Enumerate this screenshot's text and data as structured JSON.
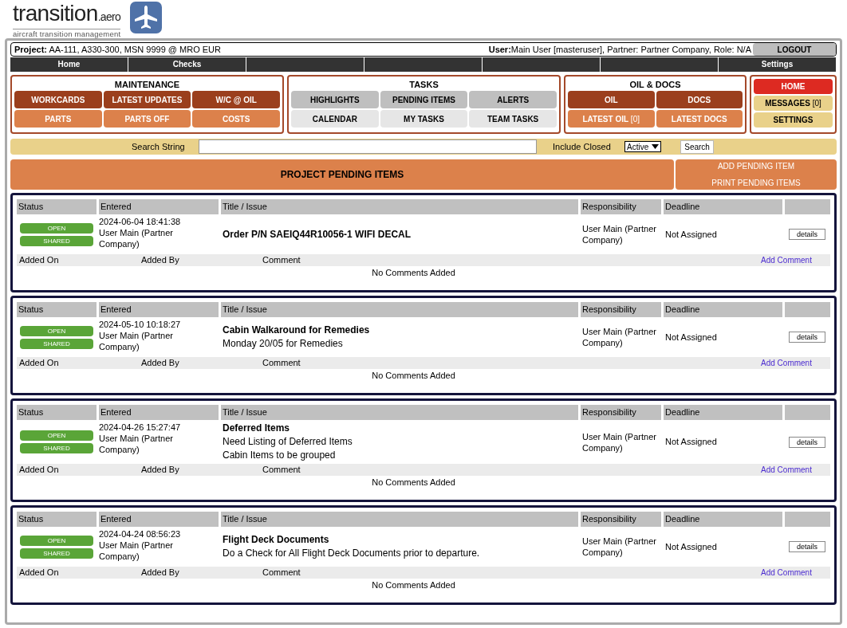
{
  "logo": {
    "name": "transition",
    "suffix": ".aero",
    "tagline": "aircraft transition management"
  },
  "project_bar": {
    "project_label": "Project:",
    "project": "AA-111, A330-300, MSN 9999 @ MRO EUR",
    "user_label": "User:",
    "user": "Main User [masteruser], Partner: Partner Company, Role: N/A",
    "logout": "LOGOUT"
  },
  "nav": [
    {
      "kind": "tab",
      "label": "Home"
    },
    {
      "kind": "tab",
      "label": "Checks"
    },
    {
      "kind": "blank"
    },
    {
      "kind": "blank"
    },
    {
      "kind": "blank"
    },
    {
      "kind": "blank"
    },
    {
      "kind": "tab",
      "label": "Settings"
    }
  ],
  "panels": [
    {
      "title": "MAINTENANCE",
      "buttons": [
        {
          "label": "WORKCARDS",
          "kind": "dark"
        },
        {
          "label": "LATEST UPDATES",
          "kind": "dark"
        },
        {
          "label": "W/C @ OIL",
          "kind": "dark"
        },
        {
          "label": "PARTS",
          "kind": "light"
        },
        {
          "label": "PARTS OFF",
          "kind": "light"
        },
        {
          "label": "COSTS",
          "kind": "light"
        }
      ]
    },
    {
      "title": "TASKS",
      "buttons": [
        {
          "label": "HIGHLIGHTS",
          "kind": "gray"
        },
        {
          "label": "PENDING ITEMS",
          "kind": "gray"
        },
        {
          "label": "ALERTS",
          "kind": "gray"
        },
        {
          "label": "CALENDAR",
          "kind": "pale"
        },
        {
          "label": "MY TASKS",
          "kind": "pale"
        },
        {
          "label": "TEAM TASKS",
          "kind": "pale"
        }
      ]
    },
    {
      "title": "OIL & DOCS",
      "buttons": [
        {
          "label": "OIL",
          "kind": "dark"
        },
        {
          "label": "DOCS",
          "kind": "dark"
        },
        {
          "label": "LATEST OIL",
          "count": "[0]",
          "kind": "light"
        },
        {
          "label": "LATEST DOCS",
          "kind": "light"
        }
      ]
    }
  ],
  "side_buttons": [
    {
      "label": "HOME",
      "kind": "red"
    },
    {
      "label": "MESSAGES",
      "count": "[0]",
      "kind": "yellow"
    },
    {
      "label": "SETTINGS",
      "kind": "yellow"
    }
  ],
  "search": {
    "label": "Search String",
    "include_closed_label": "Include Closed",
    "filter": "Active",
    "button": "Search"
  },
  "heading": {
    "title": "PROJECT PENDING ITEMS",
    "actions": [
      "ADD PENDING ITEM",
      "PRINT PENDING ITEMS"
    ]
  },
  "items": [
    {
      "columns": [
        "Status",
        "Entered",
        "Title / Issue",
        "Responsibility",
        "Deadline"
      ],
      "comment_columns": [
        "Added On",
        "Added By",
        "Comment"
      ],
      "statuses": [
        "OPEN",
        "SHARED"
      ],
      "entered": "2024-06-04 18:41:38",
      "entered_by": "User Main (Partner Company)",
      "title": "Order P/N SAEIQ44R10056-1 WIFI DECAL",
      "responsibility": "User Main (Partner Company)",
      "deadline": "Not Assigned",
      "details": "details",
      "add_comment": "Add Comment",
      "comments_note": "No Comments Added"
    },
    {
      "columns": [
        "Status",
        "Entered",
        "Title / Issue",
        "Responsibility",
        "Deadline"
      ],
      "comment_columns": [
        "Added On",
        "Added By",
        "Comment"
      ],
      "statuses": [
        "OPEN",
        "SHARED"
      ],
      "entered": "2024-05-10 10:18:27",
      "entered_by": "User Main (Partner Company)",
      "title": "Cabin Walkaround for Remedies",
      "description": [
        "Monday 20/05 for Remedies"
      ],
      "responsibility": "User Main (Partner Company)",
      "deadline": "Not Assigned",
      "details": "details",
      "add_comment": "Add Comment",
      "comments_note": "No Comments Added"
    },
    {
      "columns": [
        "Status",
        "Entered",
        "Title / Issue",
        "Responsibility",
        "Deadline"
      ],
      "comment_columns": [
        "Added On",
        "Added By",
        "Comment"
      ],
      "statuses": [
        "OPEN",
        "SHARED"
      ],
      "entered": "2024-04-26 15:27:47",
      "entered_by": "User Main (Partner Company)",
      "title": "Deferred Items",
      "description": [
        "Need Listing of Deferred Items",
        "Cabin Items to be grouped"
      ],
      "responsibility": "User Main (Partner Company)",
      "deadline": "Not Assigned",
      "details": "details",
      "add_comment": "Add Comment",
      "comments_note": "No Comments Added"
    },
    {
      "columns": [
        "Status",
        "Entered",
        "Title / Issue",
        "Responsibility",
        "Deadline"
      ],
      "comment_columns": [
        "Added On",
        "Added By",
        "Comment"
      ],
      "statuses": [
        "OPEN",
        "SHARED"
      ],
      "entered": "2024-04-24 08:56:23",
      "entered_by": "User Main (Partner Company)",
      "title": "Flight Deck Documents",
      "description": [
        "Do a Check for All Flight Deck Documents prior to departure."
      ],
      "responsibility": "User Main (Partner Company)",
      "deadline": "Not Assigned",
      "details": "details",
      "add_comment": "Add Comment",
      "comments_note": "No Comments Added"
    }
  ]
}
